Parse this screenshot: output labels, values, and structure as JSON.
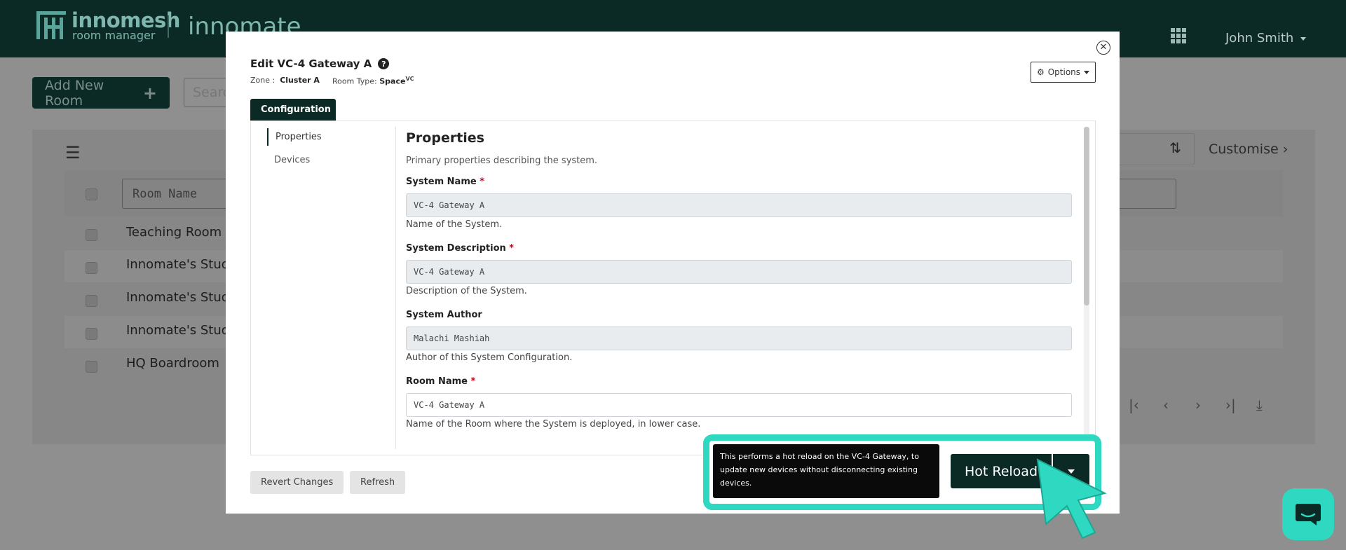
{
  "header": {
    "brand_name": "innomesh",
    "brand_sub": "room manager",
    "product": "innomate",
    "apps_icon": "apps-grid-icon",
    "user": "John Smith"
  },
  "toolbar": {
    "add_room_label": "Add New Room",
    "search_placeholder": "Searc"
  },
  "table": {
    "sort_icon": "sort-icon",
    "customise_label": "Customise",
    "filter_placeholder": "Room Name",
    "rows": [
      "Teaching Room",
      "Innomate's Studi",
      "Innomate's Studi",
      "Innomate's Studi",
      "HQ Boardroom"
    ]
  },
  "modal": {
    "title": "Edit VC-4 Gateway A",
    "zone_label": "Zone :",
    "zone_value": "Cluster A",
    "room_type_label": "Room Type:",
    "room_type_value": "Space",
    "room_type_sup": "VC",
    "options_label": "Options",
    "tab_label": "Configuration",
    "nav": [
      "Properties",
      "Devices"
    ],
    "section_title": "Properties",
    "section_desc": "Primary properties describing the system.",
    "fields": [
      {
        "label": "System Name",
        "required": "*",
        "value": "VC-4 Gateway A",
        "help": "Name of the System."
      },
      {
        "label": "System Description",
        "required": "*",
        "value": "VC-4 Gateway A",
        "help": "Description of the System."
      },
      {
        "label": "System Author",
        "required": "",
        "value": "Malachi Mashiah",
        "help": "Author of this System Configuration."
      },
      {
        "label": "Room Name",
        "required": "*",
        "value": "VC-4 Gateway A",
        "help": "Name of the Room where the System is deployed, in lower case."
      }
    ],
    "revert_label": "Revert Changes",
    "refresh_label": "Refresh"
  },
  "tooltip": {
    "text": "This performs a hot reload on the VC-4 Gateway, to update new devices without disconnecting existing devices.",
    "button_label": "Hot Reload"
  },
  "colors": {
    "brand_dark": "#0b2a26",
    "highlight": "#2fd8c0",
    "required": "#d0021b"
  }
}
